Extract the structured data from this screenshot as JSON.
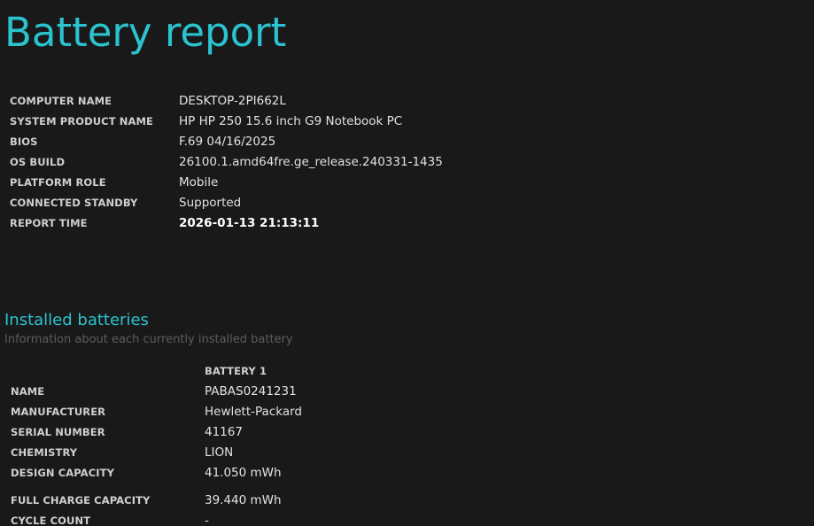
{
  "page": {
    "title": "Battery report"
  },
  "system_info": [
    {
      "label": "COMPUTER NAME",
      "value": "DESKTOP-2PI662L"
    },
    {
      "label": "SYSTEM PRODUCT NAME",
      "value": "HP HP 250 15.6 inch G9 Notebook PC"
    },
    {
      "label": "BIOS",
      "value": "F.69 04/16/2025"
    },
    {
      "label": "OS BUILD",
      "value": "26100.1.amd64fre.ge_release.240331-1435"
    },
    {
      "label": "PLATFORM ROLE",
      "value": "Mobile"
    },
    {
      "label": "CONNECTED STANDBY",
      "value": "Supported"
    },
    {
      "label": "REPORT TIME",
      "value": "2026-01-13  21:13:11"
    }
  ],
  "installed_batteries": {
    "title": "Installed batteries",
    "subtitle": "Information about each currently installed battery",
    "column_header": "BATTERY 1",
    "rows": [
      {
        "label": "NAME",
        "value": "PABAS0241231"
      },
      {
        "label": "MANUFACTURER",
        "value": "Hewlett-Packard"
      },
      {
        "label": "SERIAL NUMBER",
        "value": "41167"
      },
      {
        "label": "CHEMISTRY",
        "value": "LION"
      },
      {
        "label": "DESIGN CAPACITY",
        "value": "41.050 mWh"
      },
      {
        "label": "FULL CHARGE CAPACITY",
        "value": "39.440 mWh"
      },
      {
        "label": "CYCLE COUNT",
        "value": "-"
      }
    ]
  },
  "colors": {
    "background": "#191919",
    "accent": "#2cc3d0",
    "subtitle": "#5d5d5d"
  }
}
